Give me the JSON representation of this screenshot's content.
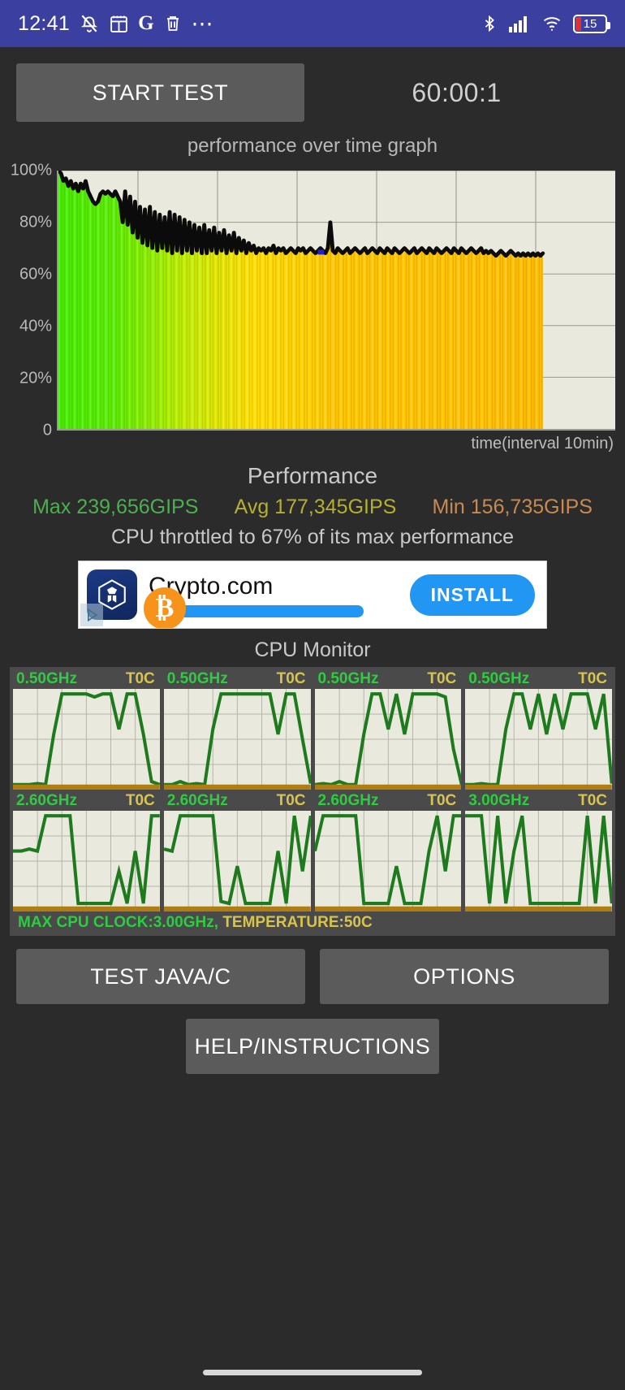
{
  "status_bar": {
    "time": "12:41",
    "battery_level": "15",
    "left_icons": [
      "mute-icon",
      "calendar-icon",
      "google-icon",
      "trash-icon",
      "more-dots-icon"
    ],
    "right_icons": [
      "bluetooth-icon",
      "cellular-signal-icon",
      "wifi-icon",
      "battery-icon"
    ],
    "background": "#3b3fa0"
  },
  "toolbar": {
    "start_test_label": "START TEST",
    "timer": "60:00:1"
  },
  "graph": {
    "title": "performance over time graph",
    "x_axis_label": "time(interval 10min)"
  },
  "performance": {
    "heading": "Performance",
    "max_label": "Max 239,656GIPS",
    "avg_label": "Avg 177,345GIPS",
    "min_label": "Min 156,735GIPS",
    "max_color": "#4caf50",
    "avg_color": "#b5b02e",
    "min_color": "#c98a52",
    "throttle_text": "CPU throttled to 67% of its max performance"
  },
  "ad": {
    "title": "Crypto.com",
    "install_label": "INSTALL",
    "icon_name": "crypto-com-logo",
    "coin_glyph": "₿",
    "accent": "#2196f3"
  },
  "cpu_monitor": {
    "title": "CPU Monitor",
    "cores": [
      {
        "ghz": "0.50GHz",
        "temp": "T0C"
      },
      {
        "ghz": "0.50GHz",
        "temp": "T0C"
      },
      {
        "ghz": "0.50GHz",
        "temp": "T0C"
      },
      {
        "ghz": "0.50GHz",
        "temp": "T0C"
      },
      {
        "ghz": "2.60GHz",
        "temp": "T0C"
      },
      {
        "ghz": "2.60GHz",
        "temp": "T0C"
      },
      {
        "ghz": "2.60GHz",
        "temp": "T0C"
      },
      {
        "ghz": "3.00GHz",
        "temp": "T0C"
      }
    ],
    "status_clock": "MAX CPU CLOCK:3.00GHz,",
    "status_temp": "TEMPERATURE:50C"
  },
  "buttons": {
    "test_java_c": "TEST JAVA/C",
    "options": "OPTIONS",
    "help": "HELP/INSTRUCTIONS"
  },
  "chart_data": {
    "type": "line",
    "title": "performance over time graph",
    "xlabel": "time(interval 10min)",
    "ylabel": "",
    "ylim": [
      0,
      100
    ],
    "ytick_labels": [
      "100%",
      "80%",
      "60%",
      "40%",
      "20%",
      "0"
    ],
    "ytick_values": [
      100,
      80,
      60,
      40,
      20,
      0
    ],
    "grid": true,
    "x_gridlines": 6,
    "data_extent_fraction": 0.87,
    "series": [
      {
        "name": "performance %",
        "values": [
          100,
          99,
          96,
          97,
          94,
          96,
          93,
          95,
          92,
          95,
          93,
          96,
          92,
          90,
          88,
          87,
          88,
          91,
          92,
          91,
          92,
          91,
          90,
          92,
          90,
          88,
          80,
          92,
          79,
          90,
          76,
          88,
          74,
          86,
          72,
          85,
          71,
          86,
          70,
          84,
          69,
          83,
          70,
          82,
          69,
          84,
          68,
          83,
          69,
          82,
          68,
          81,
          69,
          80,
          68,
          79,
          69,
          78,
          68,
          79,
          68,
          77,
          69,
          78,
          68,
          76,
          69,
          77,
          68,
          75,
          69,
          76,
          68,
          74,
          69,
          73,
          68,
          72,
          69,
          71,
          68,
          70,
          69,
          70,
          68,
          70,
          69,
          71,
          68,
          70,
          69,
          70,
          68,
          69,
          70,
          69,
          68,
          70,
          69,
          70,
          68,
          69,
          70,
          69,
          68,
          69,
          70,
          69,
          68,
          70,
          80,
          69,
          68,
          70,
          69,
          68,
          69,
          70,
          68,
          69,
          70,
          69,
          68,
          69,
          70,
          68,
          69,
          70,
          69,
          68,
          70,
          69,
          68,
          70,
          69,
          68,
          70,
          69,
          68,
          69,
          70,
          69,
          68,
          69,
          70,
          68,
          69,
          70,
          69,
          68,
          70,
          69,
          68,
          70,
          69,
          68,
          69,
          70,
          69,
          68,
          70,
          69,
          68,
          70,
          69,
          68,
          69,
          70,
          69,
          68,
          69,
          70,
          68,
          69,
          68,
          69,
          68,
          67,
          68,
          69,
          68,
          67,
          68,
          69,
          68,
          67,
          68,
          67,
          68,
          67,
          68,
          67,
          68,
          67,
          68,
          67,
          68
        ]
      }
    ],
    "area_fill": "green-to-orange-gradient",
    "line_color": "#000000",
    "plot_background": "#e9e9de"
  }
}
